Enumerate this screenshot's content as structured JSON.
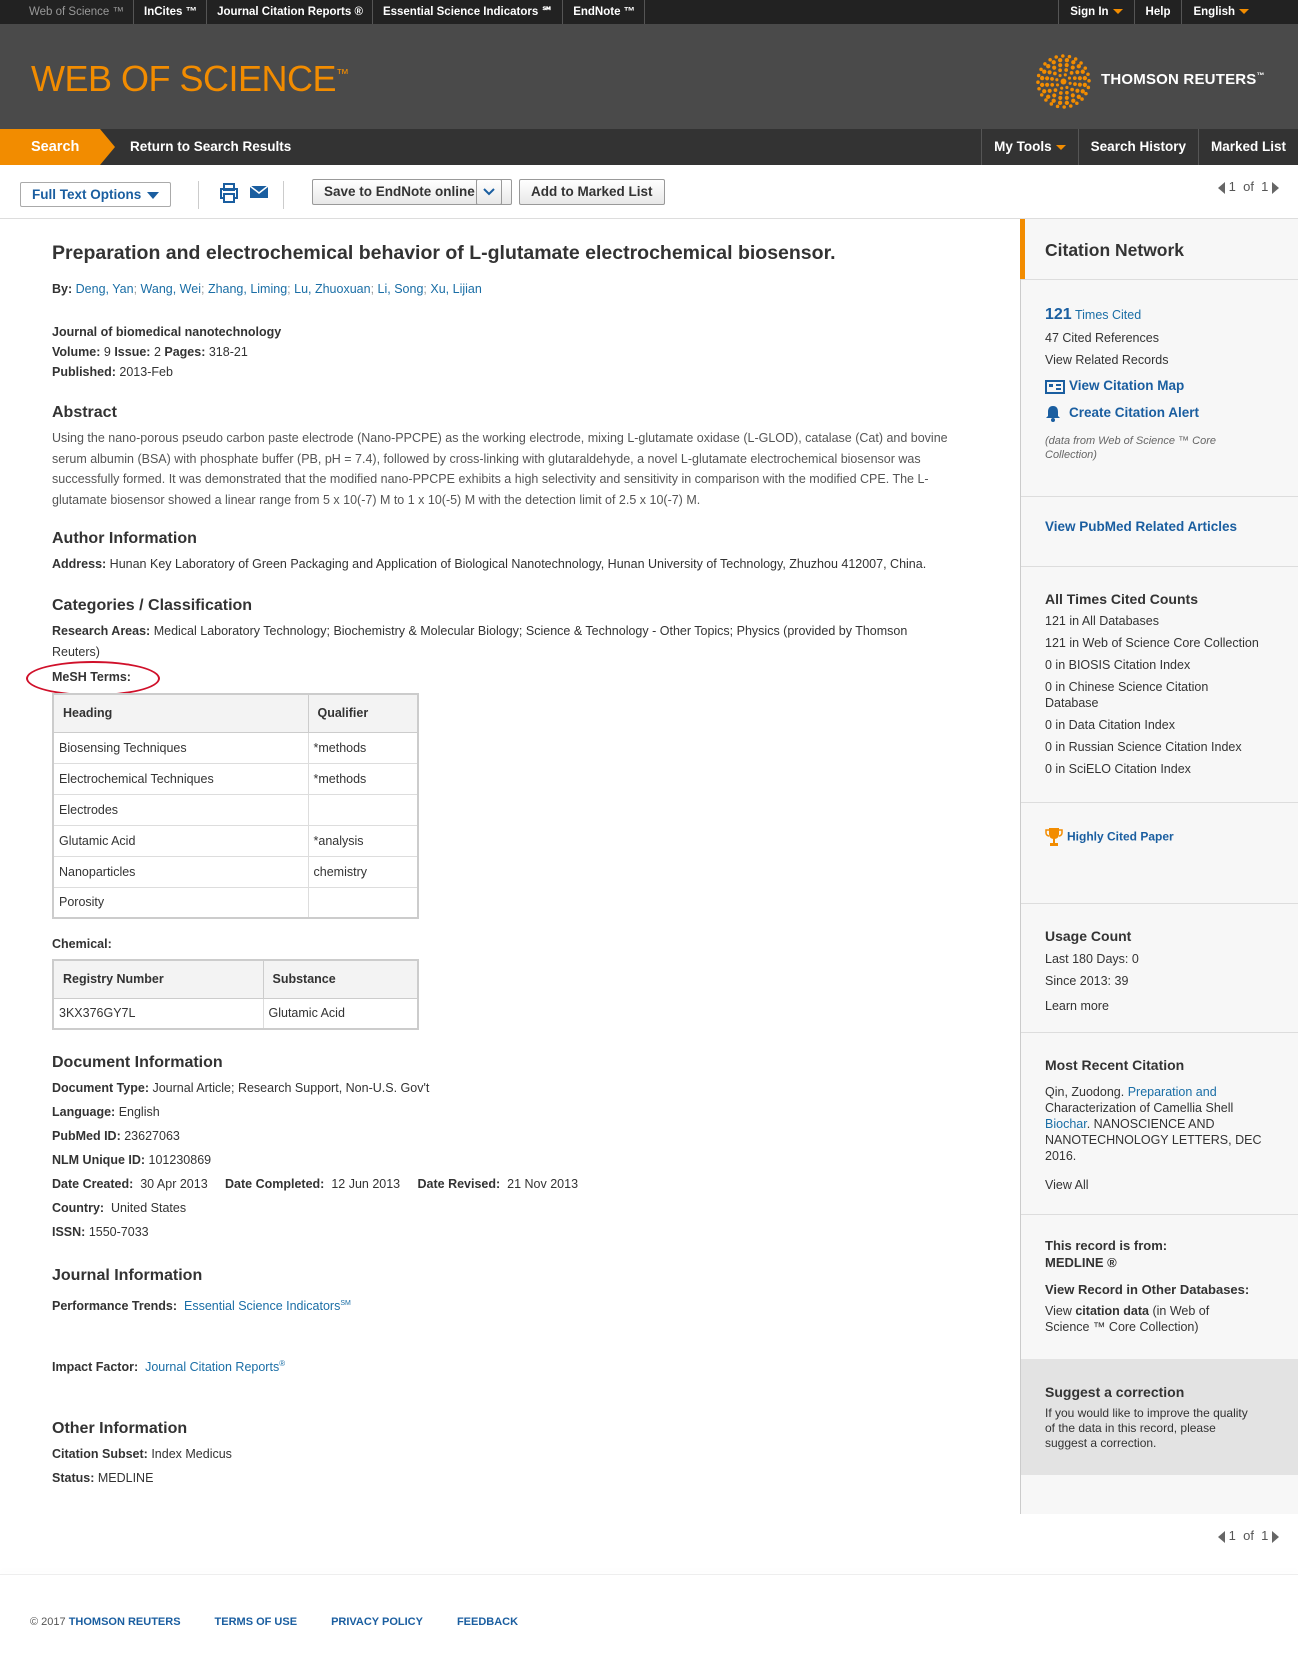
{
  "topbar": {
    "products": [
      "Web of Science ™",
      "InCites ™",
      "Journal Citation Reports ®",
      "Essential Science Indicators ℠",
      "EndNote ™"
    ],
    "sign_in": "Sign In",
    "help": "Help",
    "language": "English"
  },
  "header": {
    "logo": "WEB OF SCIENCE",
    "logo_tm": "™",
    "company": "THOMSON REUTERS",
    "company_tm": "™"
  },
  "nav": {
    "search": "Search",
    "return": "Return to Search Results",
    "my_tools": "My Tools",
    "search_history": "Search History",
    "marked_list": "Marked List"
  },
  "toolbar": {
    "full_text": "Full Text Options",
    "save": "Save to EndNote online",
    "add_marked": "Add to Marked List",
    "page_current": "1",
    "page_of": "of",
    "page_total": "1"
  },
  "record": {
    "title": "Preparation and electrochemical behavior of L-glutamate electrochemical biosensor.",
    "by_label": "By:",
    "authors": [
      "Deng, Yan",
      "Wang, Wei",
      "Zhang, Liming",
      "Lu, Zhuoxuan",
      "Li, Song",
      "Xu, Lijian"
    ],
    "journal": "Journal of biomedical nanotechnology",
    "volume_label": "Volume:",
    "volume": "9",
    "issue_label": "Issue:",
    "issue": "2",
    "pages_label": "Pages:",
    "pages": "318-21",
    "published_label": "Published:",
    "published": "2013-Feb",
    "abstract_heading": "Abstract",
    "abstract": "Using the nano-porous pseudo carbon paste electrode (Nano-PPCPE) as the working electrode, mixing L-glutamate oxidase (L-GLOD), catalase (Cat) and bovine serum albumin (BSA) with phosphate buffer (PB, pH = 7.4), followed by cross-linking with glutaraldehyde, a novel L-glutamate electrochemical biosensor was successfully formed. It was demonstrated that the modified nano-PPCPE exhibits a high selectivity and sensitivity in comparison with the modified CPE. The L-glutamate biosensor showed a linear range from 5 x 10(-7) M to 1 x 10(-5) M with the detection limit of 2.5 x 10(-7) M.",
    "author_info_heading": "Author Information",
    "address_label": "Address:",
    "address": "Hunan Key Laboratory of Green Packaging and Application of Biological Nanotechnology, Hunan University of Technology, Zhuzhou 412007, China.",
    "categories_heading": "Categories / Classification",
    "research_areas_label": "Research Areas:",
    "research_areas_1": "Medical Laboratory Technology; Biochemistry & Molecular Biology; Science & Technology - Other Topics; Physics (provided by Thomson",
    "research_areas_2": "Reuters)",
    "mesh_label": "MeSH Terms:",
    "mesh_headers": [
      "Heading",
      "Qualifier"
    ],
    "mesh_rows": [
      [
        "Biosensing Techniques",
        "*methods"
      ],
      [
        "Electrochemical Techniques",
        "*methods"
      ],
      [
        "Electrodes",
        ""
      ],
      [
        "Glutamic Acid",
        "*analysis"
      ],
      [
        "Nanoparticles",
        "chemistry"
      ],
      [
        "Porosity",
        ""
      ]
    ],
    "chemical_label": "Chemical:",
    "chem_headers": [
      "Registry Number",
      "Substance"
    ],
    "chem_rows": [
      [
        "3KX376GY7L",
        "Glutamic Acid"
      ]
    ],
    "doc_info_heading": "Document Information",
    "doc_type_label": "Document Type:",
    "doc_type": "Journal Article; Research Support, Non-U.S. Gov't",
    "language_label": "Language:",
    "language": "English",
    "pubmed_label": "PubMed ID:",
    "pubmed": "23627063",
    "nlm_label": "NLM Unique ID:",
    "nlm": "101230869",
    "created_label": "Date Created:",
    "created": "30 Apr 2013",
    "completed_label": "Date Completed:",
    "completed": "12 Jun 2013",
    "revised_label": "Date Revised:",
    "revised": "21 Nov 2013",
    "country_label": "Country:",
    "country": "United States",
    "issn_label": "ISSN:",
    "issn": "1550-7033",
    "journal_info_heading": "Journal Information",
    "perf_label": "Performance Trends:",
    "perf_link": "Essential Science Indicators",
    "perf_sup": "SM",
    "if_label": "Impact Factor:",
    "if_link": "Journal Citation Reports",
    "if_sup": "®",
    "other_heading": "Other Information",
    "subset_label": "Citation Subset:",
    "subset": "Index Medicus",
    "status_label": "Status:",
    "status": "MEDLINE"
  },
  "sidebar": {
    "citation_network": "Citation Network",
    "times_cited_num": "121",
    "times_cited": "Times Cited",
    "cited_refs": "47 Cited References",
    "related": "View Related Records",
    "citation_map": "View Citation Map",
    "alert": "Create Citation Alert",
    "data_note_1": "(data from Web of Science ™ Core",
    "data_note_2": "Collection)",
    "pubmed_related": "View PubMed Related Articles",
    "all_times_heading": "All Times Cited Counts",
    "all_times": [
      "121 in All Databases",
      "121 in Web of Science Core Collection",
      "0 in BIOSIS Citation Index",
      "0 in Chinese Science Citation",
      "Database",
      "0 in Data Citation Index",
      "0 in Russian Science Citation Index",
      "0 in SciELO Citation Index"
    ],
    "highly_cited": "Highly Cited Paper",
    "usage_heading": "Usage Count",
    "last180": "Last 180 Days: 0",
    "since2013": "Since 2013: 39",
    "learn_more": "Learn more",
    "recent_heading": "Most Recent Citation",
    "recent_author": "Qin, Zuodong.",
    "recent_title_1": "Preparation and",
    "recent_title_2": "Characterization of Camellia Shell",
    "recent_title_3": "Biochar",
    "recent_src_1": ". NANOSCIENCE AND",
    "recent_src_2": "NANOTECHNOLOGY LETTERS, DEC",
    "recent_src_3": "2016.",
    "view_all": "View All",
    "record_from": "This record is from:",
    "medline": "MEDLINE ®",
    "other_db": "View Record in Other Databases:",
    "view_citation_1": "View",
    "view_citation_2": "citation data",
    "view_citation_3": "(in Web of",
    "view_citation_4": "Science ™ Core Collection)",
    "suggest_heading": "Suggest a correction",
    "suggest_1": "If you would like to improve the quality",
    "suggest_2": "of the data in this record, please",
    "suggest_3": "suggest a correction."
  },
  "footer": {
    "copyright": "© 2017",
    "company": "THOMSON REUTERS",
    "terms": "TERMS OF USE",
    "privacy": "PRIVACY POLICY",
    "feedback": "FEEDBACK"
  },
  "colors": {
    "accent": "#f28c00",
    "link": "#1a6ea6",
    "annotation": "#d0102a"
  }
}
